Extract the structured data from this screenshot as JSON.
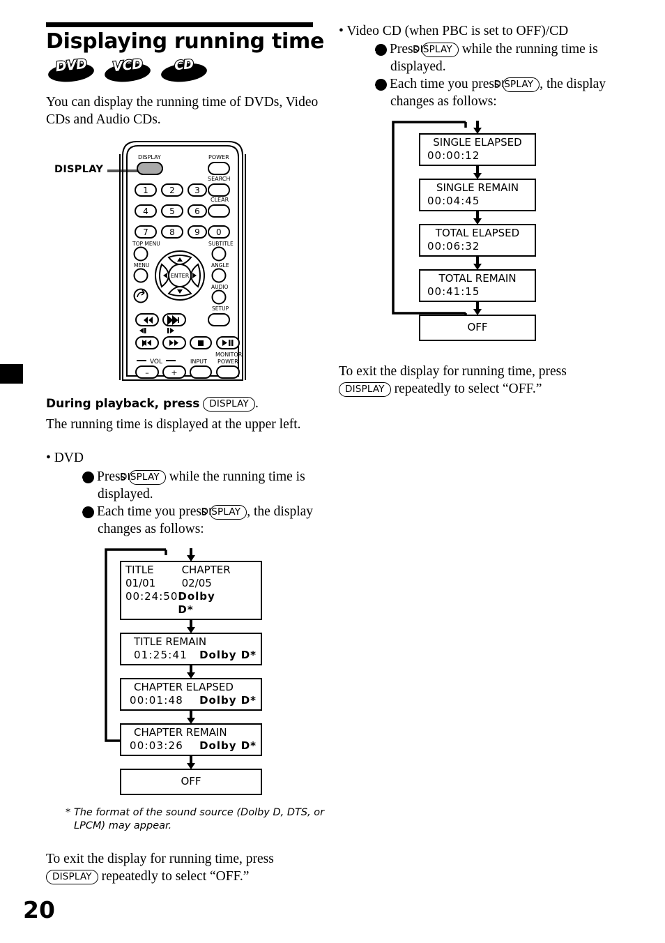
{
  "page": {
    "number": "20"
  },
  "heading": {
    "title": "Displaying running time",
    "badges": [
      {
        "label": "DVD",
        "name": "dvd-badge"
      },
      {
        "label": "VCD",
        "name": "vcd-badge"
      },
      {
        "label": "CD",
        "name": "cd-badge"
      }
    ],
    "intro": "You can display the running time of DVDs, Video CDs and Audio CDs."
  },
  "remote": {
    "callout_label": "DISPLAY",
    "buttons": {
      "display": "DISPLAY",
      "power": "POWER",
      "search": "SEARCH",
      "clear": "CLEAR",
      "top_menu": "TOP MENU",
      "menu": "MENU",
      "subtitle": "SUBTITLE",
      "angle": "ANGLE",
      "audio": "AUDIO",
      "setup": "SETUP",
      "enter": "ENTER",
      "vol": "VOL",
      "vol_minus": "–",
      "vol_plus": "+",
      "input": "INPUT",
      "monitor_power_l1": "MONITOR",
      "monitor_power_l2": "POWER"
    },
    "numbers": [
      "1",
      "2",
      "3",
      "4",
      "5",
      "6",
      "7",
      "8",
      "9",
      "0"
    ]
  },
  "left_column": {
    "instruction_bold": "During playback, press",
    "instruction_pill": "DISPLAY",
    "instruction_tail": ".",
    "instruction_detail": "The running time is displayed at the upper left.",
    "section_bullet": "• DVD",
    "step1_pre": "Press",
    "step1_pill": "DISPLAY",
    "step1_post": "while the running time is displayed.",
    "step2_pre": "Each time you press",
    "step2_pill": "DISPLAY",
    "step2_post": ", the display changes as follows:",
    "footnote": "* The format of the sound source (Dolby D, DTS, or LPCM) may appear.",
    "exit_pre": "To exit the display for running time, press",
    "exit_pill": "DISPLAY",
    "exit_post": "repeatedly to select “OFF.”"
  },
  "right_column": {
    "section_bullet": "• Video CD (when PBC is set to OFF)/CD",
    "step1_pre": "Press",
    "step1_pill": "DISPLAY",
    "step1_post": "while the running time is displayed.",
    "step2_pre": "Each time you press",
    "step2_pill": "DISPLAY",
    "step2_post": ", the display changes as follows:",
    "exit_pre": "To exit the display for running time, press",
    "exit_pill": "DISPLAY",
    "exit_post": "repeatedly to select “OFF.”"
  },
  "dvd_flow": [
    {
      "line1_a": "TITLE 01/01",
      "line1_b": "CHAPTER 02/05",
      "line2_a": "00:24:50",
      "line2_b": "Dolby D*",
      "center": false
    },
    {
      "line1_a": "TITLE REMAIN",
      "line1_b": "",
      "line2_a": "01:25:41",
      "line2_b": "Dolby D*",
      "center": false
    },
    {
      "line1_a": "CHAPTER ELAPSED",
      "line1_b": "",
      "line2_a": "00:01:48",
      "line2_b": "Dolby D*",
      "center": false
    },
    {
      "line1_a": "CHAPTER REMAIN",
      "line1_b": "",
      "line2_a": "00:03:26",
      "line2_b": "Dolby D*",
      "center": false
    },
    {
      "line1_a": "OFF",
      "line1_b": "",
      "line2_a": "",
      "line2_b": "",
      "center": true
    }
  ],
  "cd_flow": [
    {
      "line1_a": "SINGLE ELAPSED",
      "line2_a": "00:00:12",
      "center": false
    },
    {
      "line1_a": "SINGLE REMAIN",
      "line2_a": "00:04:45",
      "center": false
    },
    {
      "line1_a": "TOTAL ELAPSED",
      "line2_a": "00:06:32",
      "center": false
    },
    {
      "line1_a": "TOTAL REMAIN",
      "line2_a": "00:41:15",
      "center": false
    },
    {
      "line1_a": "OFF",
      "line2_a": "",
      "center": true
    }
  ]
}
